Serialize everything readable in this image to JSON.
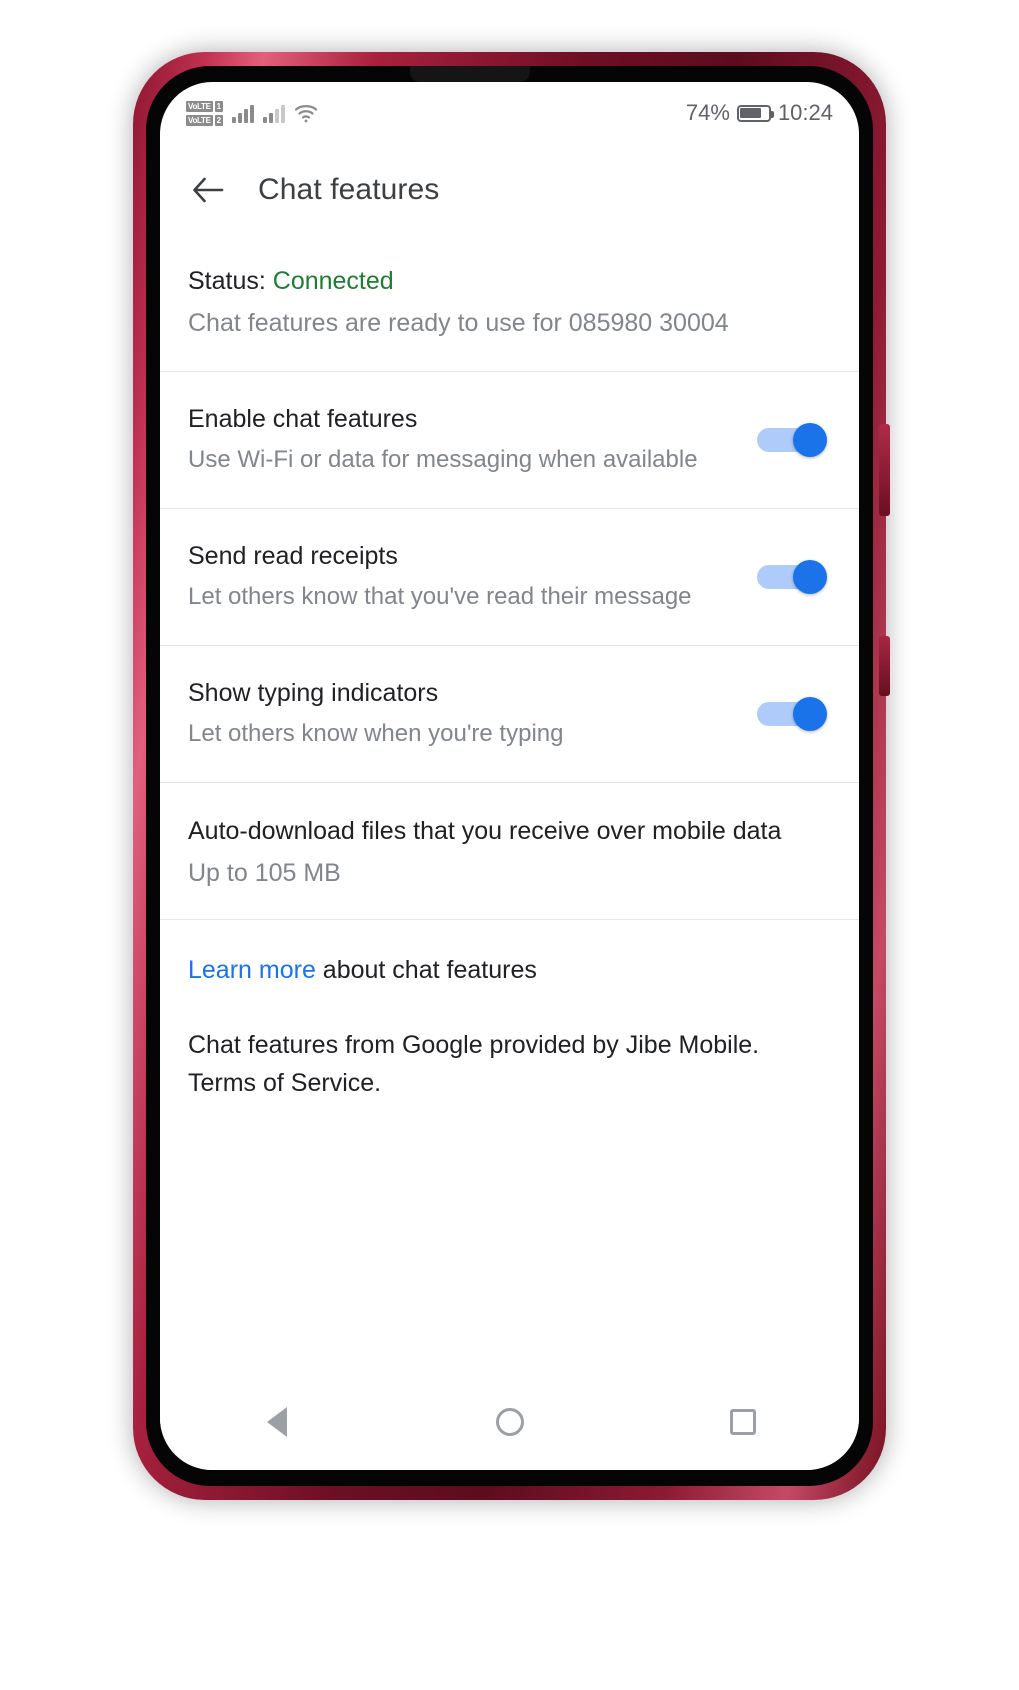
{
  "statusbar": {
    "volte1_label": "VoLTE",
    "volte1_sim": "1",
    "volte2_label": "VoLTE",
    "volte2_sim": "2",
    "signal1_icon": "signal-bars-icon",
    "signal2_icon": "signal-bars-icon",
    "wifi_icon": "wifi-icon",
    "battery_percent": "74%",
    "battery_icon": "battery-icon",
    "time": "10:24"
  },
  "appbar": {
    "back_icon": "back-arrow-icon",
    "title": "Chat features"
  },
  "status_section": {
    "label": "Status: ",
    "value": "Connected",
    "value_color": "#1e7e34",
    "description": "Chat features are ready to use for 085980 30004",
    "phone_number": "08598030004"
  },
  "settings": [
    {
      "title": "Enable chat features",
      "subtitle": "Use Wi-Fi or data for messaging when available",
      "toggle_state": "on",
      "toggle_name": "enable-chat-features-toggle"
    },
    {
      "title": "Send read receipts",
      "subtitle": "Let others know that you've read their message",
      "toggle_state": "on",
      "toggle_name": "send-read-receipts-toggle"
    },
    {
      "title": "Show typing indicators",
      "subtitle": "Let others know when you're typing",
      "toggle_state": "on",
      "toggle_name": "show-typing-indicators-toggle"
    }
  ],
  "auto_download": {
    "title": "Auto-download files that you receive over mobile data",
    "subtitle": "Up to 105 MB"
  },
  "footer": {
    "link_text": "Learn more",
    "link_suffix": " about chat features",
    "note": "Chat features from Google provided by Jibe Mobile. Terms of Service."
  },
  "navbar": {
    "back_icon": "nav-back-triangle-icon",
    "home_icon": "nav-home-circle-icon",
    "recents_icon": "nav-recents-square-icon"
  },
  "colors": {
    "accent": "#1a73e8",
    "toggle_track": "#aecbfa",
    "connected_green": "#1e7e34",
    "primary_text": "#202124",
    "secondary_text": "#80868b"
  }
}
